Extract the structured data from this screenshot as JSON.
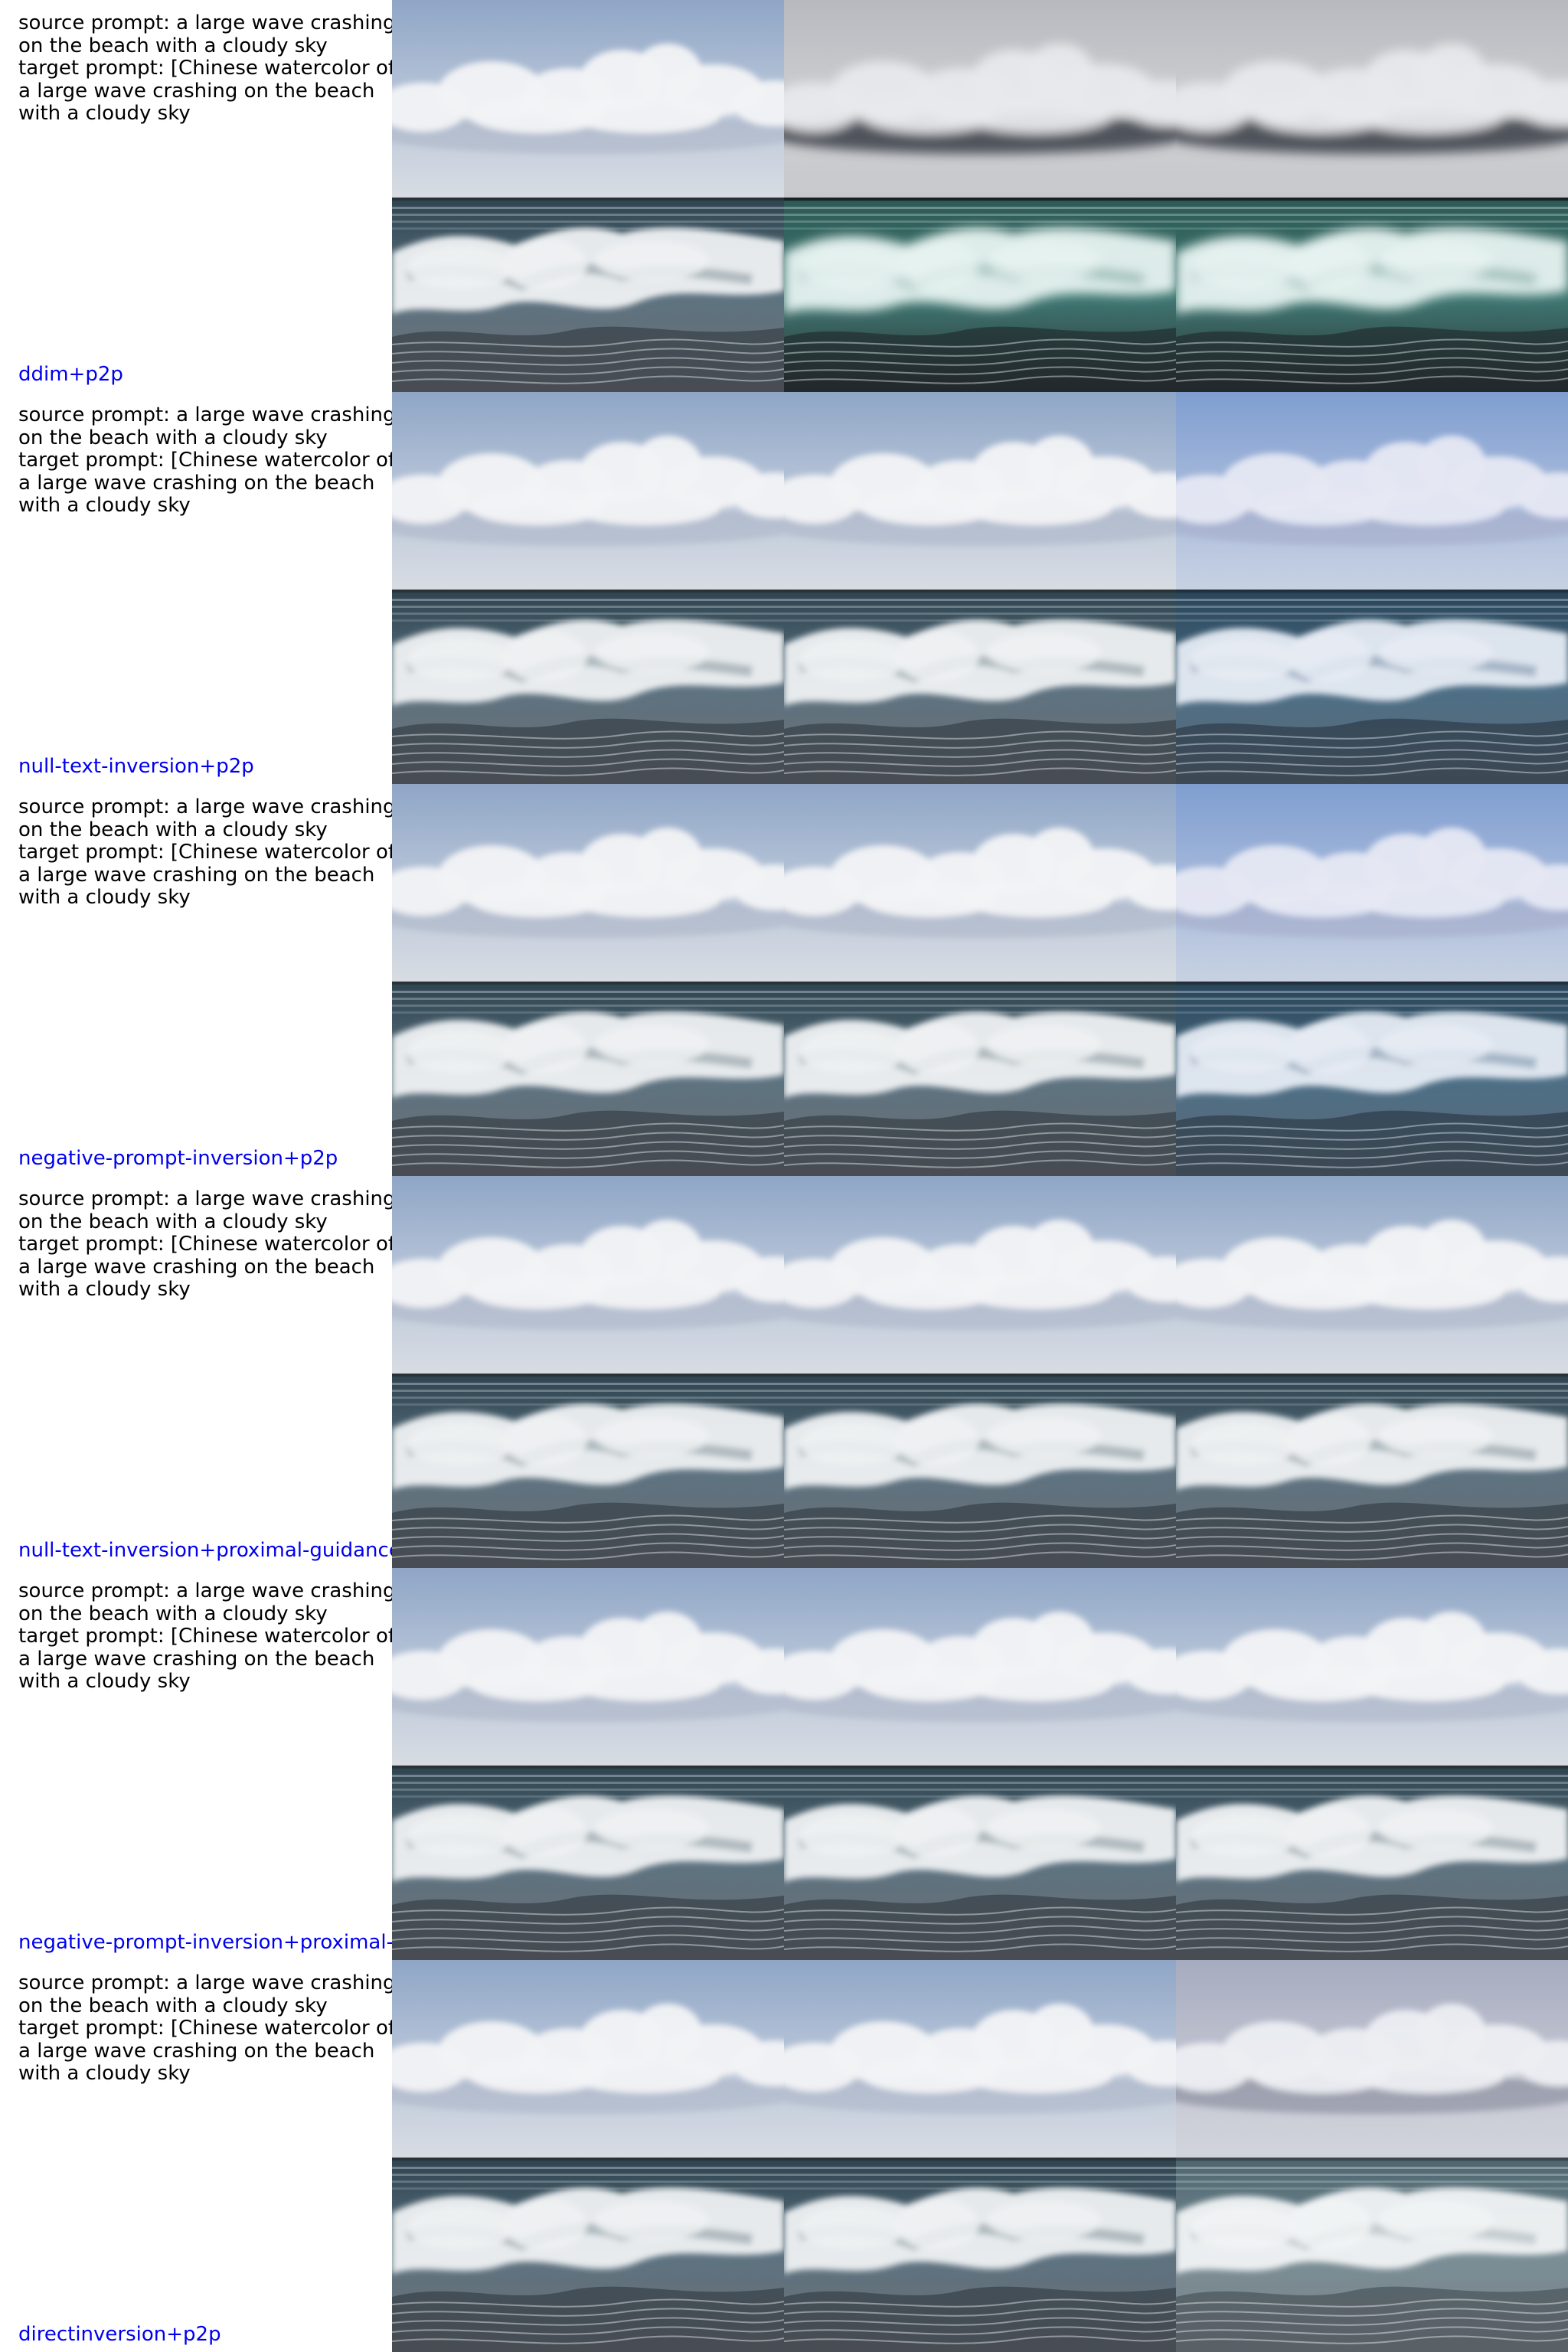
{
  "rows": [
    {
      "prompt_lines": [
        "source prompt: a large wave crashing",
        "on the beach with a cloudy sky",
        "target prompt: [Chinese watercolor of]",
        "a large wave crashing on the beach",
        "with a cloudy sky"
      ],
      "method": "ddim+p2p",
      "tiles": [
        {
          "image": "source photo: cloudy sky over crashing ocean wave"
        },
        {
          "image": "edited result: darker stormy cloud band, teal-white wave"
        },
        {
          "image": "edited result: darker stormy cloud band, teal-white wave"
        }
      ]
    },
    {
      "prompt_lines": [
        "source prompt: a large wave crashing",
        "on the beach with a cloudy sky",
        "target prompt: [Chinese watercolor of]",
        "a large wave crashing on the beach",
        "with a cloudy sky"
      ],
      "method": "null-text-inversion+p2p",
      "tiles": [
        {
          "image": "source photo: cloudy sky over crashing ocean wave"
        },
        {
          "image": "reconstruction: cloudy sky over crashing ocean wave"
        },
        {
          "image": "edited result: textured painterly clouds and wave"
        }
      ]
    },
    {
      "prompt_lines": [
        "source prompt: a large wave crashing",
        "on the beach with a cloudy sky",
        "target prompt: [Chinese watercolor of]",
        "a large wave crashing on the beach",
        "with a cloudy sky"
      ],
      "method": "negative-prompt-inversion+p2p",
      "tiles": [
        {
          "image": "source photo: cloudy sky over crashing ocean wave"
        },
        {
          "image": "reconstruction: cloudy sky over crashing ocean wave"
        },
        {
          "image": "edited result: painterly clouds and blue-toned wave"
        }
      ]
    },
    {
      "prompt_lines": [
        "source prompt: a large wave crashing",
        "on the beach with a cloudy sky",
        "target prompt: [Chinese watercolor of]",
        "a large wave crashing on the beach",
        "with a cloudy sky"
      ],
      "method": "null-text-inversion+proximal-guidance",
      "tiles": [
        {
          "image": "source photo: cloudy sky over crashing ocean wave"
        },
        {
          "image": "reconstruction: cloudy sky over crashing ocean wave"
        },
        {
          "image": "edited result: nearly unchanged cloudy sky and wave"
        }
      ]
    },
    {
      "prompt_lines": [
        "source prompt: a large wave crashing",
        "on the beach with a cloudy sky",
        "target prompt: [Chinese watercolor of]",
        "a large wave crashing on the beach",
        "with a cloudy sky"
      ],
      "method": "negative-prompt-inversion+proximal-g",
      "tiles": [
        {
          "image": "source photo: cloudy sky over crashing ocean wave"
        },
        {
          "image": "reconstruction: cloudy sky over crashing ocean wave"
        },
        {
          "image": "edited result: nearly unchanged cloudy sky and wave"
        }
      ]
    },
    {
      "prompt_lines": [
        "source prompt: a large wave crashing",
        "on the beach with a cloudy sky",
        "target prompt: [Chinese watercolor of]",
        "a large wave crashing on the beach",
        "with a cloudy sky"
      ],
      "method": "directinversion+p2p",
      "tiles": [
        {
          "image": "source photo: cloudy sky over crashing ocean wave"
        },
        {
          "image": "reconstruction: cloudy sky over crashing ocean wave"
        },
        {
          "image": "edited result: soft grey sky, soft misty wave"
        }
      ]
    }
  ],
  "colors": {
    "prompt_text": "#000000",
    "method_text": "#0000ee",
    "background": "#ffffff"
  },
  "tile_styles": [
    [
      "photo",
      "storm",
      "storm"
    ],
    [
      "photo",
      "photo",
      "paint"
    ],
    [
      "photo",
      "photo",
      "paint"
    ],
    [
      "photo",
      "photo",
      "photo"
    ],
    [
      "photo",
      "photo",
      "photo"
    ],
    [
      "photo",
      "photo",
      "soft"
    ]
  ]
}
